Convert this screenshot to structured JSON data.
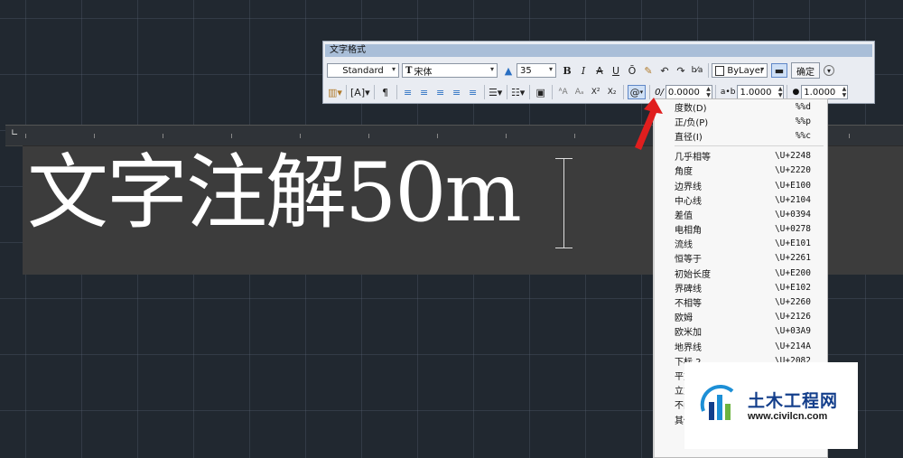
{
  "toolbar": {
    "title": "文字格式",
    "style": "Standard",
    "font_icon": "T",
    "font": "宋体",
    "height": "35",
    "bold": "B",
    "italic": "I",
    "strike": "A",
    "underline": "U",
    "overline": "Ō",
    "color": "ByLayer",
    "ok": "确定",
    "symbol": "@",
    "oblique_label": "0/",
    "oblique": "0.0000",
    "tracking_label": "a•b",
    "tracking": "1.0000",
    "width_label": "●",
    "width": "1.0000",
    "superscript": "X²",
    "subscript": "X₂"
  },
  "editor": {
    "text": "文字注解50m"
  },
  "symbol_menu": {
    "items": [
      {
        "name": "度数(D)",
        "code": "%%d"
      },
      {
        "name": "正/负(P)",
        "code": "%%p"
      },
      {
        "name": "直径(I)",
        "code": "%%c"
      },
      {
        "name": "几乎相等",
        "code": "\\U+2248"
      },
      {
        "name": "角度",
        "code": "\\U+2220"
      },
      {
        "name": "边界线",
        "code": "\\U+E100"
      },
      {
        "name": "中心线",
        "code": "\\U+2104"
      },
      {
        "name": "差值",
        "code": "\\U+0394"
      },
      {
        "name": "电相角",
        "code": "\\U+0278"
      },
      {
        "name": "流线",
        "code": "\\U+E101"
      },
      {
        "name": "恒等于",
        "code": "\\U+2261"
      },
      {
        "name": "初始长度",
        "code": "\\U+E200"
      },
      {
        "name": "界碑线",
        "code": "\\U+E102"
      },
      {
        "name": "不相等",
        "code": "\\U+2260"
      },
      {
        "name": "欧姆",
        "code": "\\U+2126"
      },
      {
        "name": "欧米加",
        "code": "\\U+03A9"
      },
      {
        "name": "地界线",
        "code": "\\U+214A"
      },
      {
        "name": "下标 2",
        "code": "\\U+2082"
      },
      {
        "name": "平方",
        "code": ""
      },
      {
        "name": "立方",
        "code": ""
      },
      {
        "name": "不间断空格",
        "code": ""
      },
      {
        "name": "其他",
        "code": ""
      }
    ]
  },
  "watermark": {
    "name": "土木工程网",
    "url": "www.civilcn.com"
  },
  "colors": {
    "canvas": "#212830",
    "editor": "#3c3c3c",
    "arrow": "#e01e1e",
    "brand": "#133e8b"
  }
}
